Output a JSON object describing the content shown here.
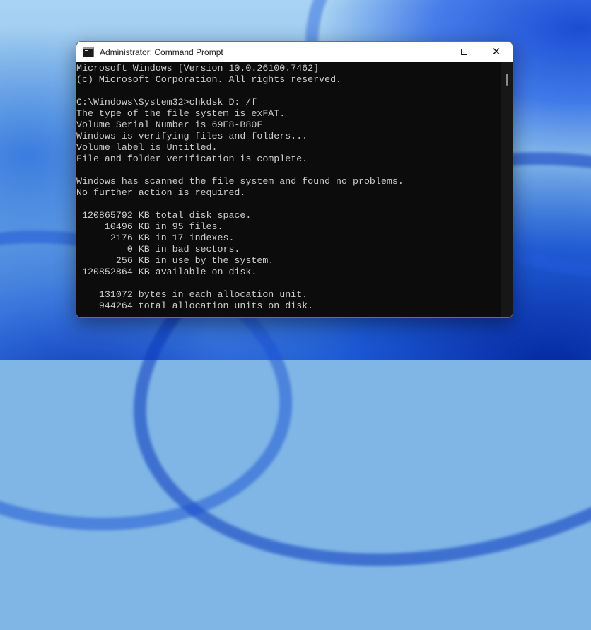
{
  "window": {
    "title": "Administrator: Command Prompt",
    "controls": {
      "minimize_icon": "minimize-icon",
      "maximize_icon": "maximize-icon",
      "close_glyph": "✕"
    }
  },
  "console": {
    "lines": [
      "Microsoft Windows [Version 10.0.26100.7462]",
      "(c) Microsoft Corporation. All rights reserved.",
      "",
      "C:\\Windows\\System32>chkdsk D: /f",
      "The type of the file system is exFAT.",
      "Volume Serial Number is 69E8-B80F",
      "Windows is verifying files and folders...",
      "Volume label is Untitled.",
      "File and folder verification is complete.",
      "",
      "Windows has scanned the file system and found no problems.",
      "No further action is required.",
      "",
      " 120865792 KB total disk space.",
      "     10496 KB in 95 files.",
      "      2176 KB in 17 indexes.",
      "         0 KB in bad sectors.",
      "       256 KB in use by the system.",
      " 120852864 KB available on disk.",
      "",
      "    131072 bytes in each allocation unit.",
      "    944264 total allocation units on disk."
    ]
  }
}
